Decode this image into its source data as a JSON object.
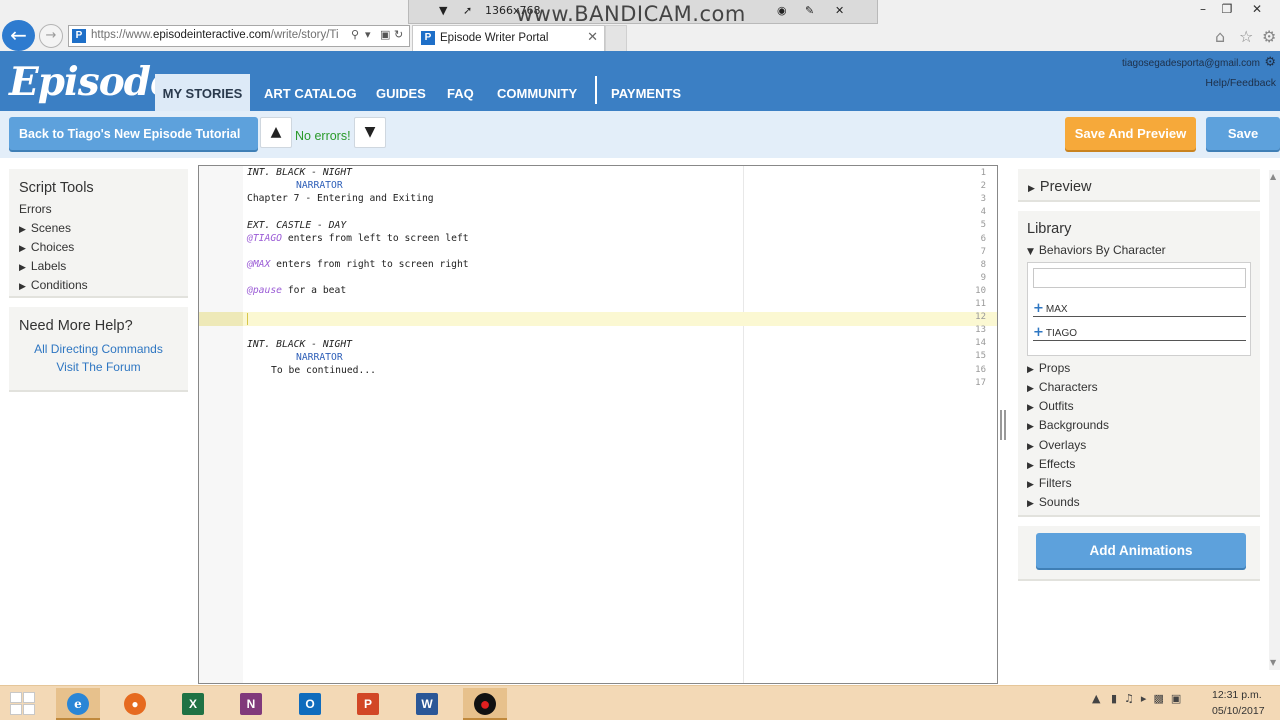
{
  "browser": {
    "url_prefix": "https://www.",
    "url_domain": "episodeinteractive.com",
    "url_path": "/write/story/Ti",
    "tab_title": "Episode Writer Portal",
    "recorder_resolution": "1366x768",
    "recorder_watermark": "www.BANDICAM.com"
  },
  "header": {
    "logo": "Episode",
    "nav": [
      "MY STORIES",
      "ART CATALOG",
      "GUIDES",
      "FAQ",
      "COMMUNITY",
      "PAYMENTS"
    ],
    "user_email": "tiagosegadesporta@gmail.com",
    "help_feedback": "Help/Feedback"
  },
  "toolbar": {
    "back_label": "Back to Tiago's New Episode Tutorial",
    "status": "No errors!",
    "save_preview_label": "Save And Preview",
    "save_label": "Save"
  },
  "script_tools": {
    "title": "Script Tools",
    "errors": "Errors",
    "items": [
      "Scenes",
      "Choices",
      "Labels",
      "Conditions"
    ]
  },
  "help": {
    "title": "Need More Help?",
    "links": [
      "All Directing Commands",
      "Visit The Forum"
    ]
  },
  "editor": {
    "line_numbers": [
      "1",
      "2",
      "3",
      "4",
      "5",
      "6",
      "7",
      "8",
      "9",
      "10",
      "11",
      "12",
      "13",
      "14",
      "15",
      "16",
      "17"
    ],
    "lines": {
      "l1": "INT. BLACK - NIGHT",
      "l2": "NARRATOR",
      "l3": "Chapter 7 - Entering and Exiting",
      "l5": "EXT. CASTLE - DAY",
      "l6_char": "@TIAGO",
      "l6_rest": " enters from left to screen left",
      "l8_char": "@MAX",
      "l8_rest": " enters from right to screen right",
      "l10_char": "@pause",
      "l10_rest": " for a beat",
      "l14": "INT. BLACK - NIGHT",
      "l15": "NARRATOR",
      "l16": "To be continued..."
    }
  },
  "right_panel": {
    "preview_title": "Preview",
    "library_title": "Library",
    "behaviors_label": "Behaviors By Character",
    "characters": [
      "MAX",
      "TIAGO"
    ],
    "library_items": [
      "Props",
      "Characters",
      "Outfits",
      "Backgrounds",
      "Overlays",
      "Effects",
      "Filters",
      "Sounds"
    ],
    "add_animations_label": "Add Animations"
  },
  "taskbar": {
    "clock_time": "12:31 p.m.",
    "clock_date": "05/10/2017",
    "apps": [
      "X",
      "N",
      "O",
      "P",
      "W"
    ]
  },
  "colors": {
    "header_blue": "#3b7fc4",
    "button_blue": "#5da1dc",
    "button_orange": "#f6a93a",
    "success_green": "#2a9a2a",
    "narrator_blue": "#2e5fb8",
    "action_purple": "#9b5cd6"
  }
}
